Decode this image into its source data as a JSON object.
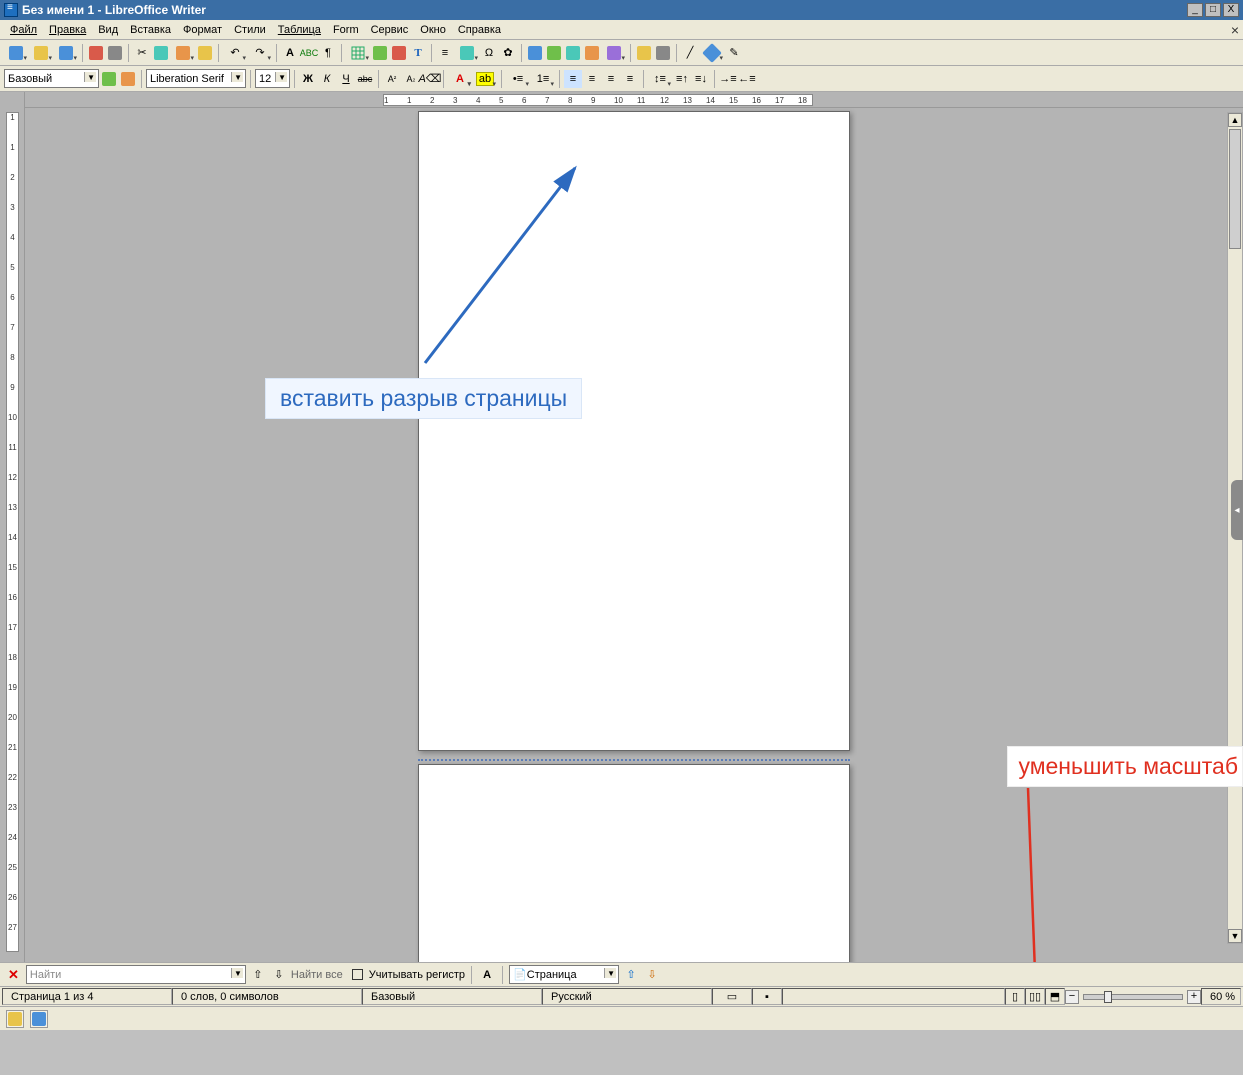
{
  "window": {
    "title": "Без имени 1 - LibreOffice Writer"
  },
  "menus": {
    "file": "Файл",
    "edit": "Правка",
    "view": "Вид",
    "insert": "Вставка",
    "format": "Формат",
    "styles": "Стили",
    "table": "Таблица",
    "form": "Form",
    "tools": "Сервис",
    "window": "Окно",
    "help": "Справка"
  },
  "formatbar": {
    "paragraph_style": "Базовый",
    "font_name": "Liberation Serif",
    "font_size": "12",
    "bold": "Ж",
    "italic": "К",
    "underline": "Ч",
    "strike": "abc"
  },
  "find": {
    "placeholder": "Найти",
    "find_all": "Найти все",
    "case_label": "Учитывать регистр",
    "nav_dropdown": "Страница"
  },
  "status": {
    "page": "Страница 1 из 4",
    "words": "0 слов, 0 символов",
    "style": "Базовый",
    "language": "Русский",
    "zoom": "60 %"
  },
  "hruler_ticks": [
    "1",
    "1",
    "2",
    "3",
    "4",
    "5",
    "6",
    "7",
    "8",
    "9",
    "10",
    "11",
    "12",
    "13",
    "14",
    "15",
    "16",
    "17",
    "18"
  ],
  "vruler_ticks": [
    "1",
    "1",
    "2",
    "3",
    "4",
    "5",
    "6",
    "7",
    "8",
    "9",
    "10",
    "11",
    "12",
    "13",
    "14",
    "15",
    "16",
    "17",
    "18",
    "19",
    "20",
    "21",
    "22",
    "23",
    "24",
    "25",
    "26",
    "27"
  ],
  "annotations": {
    "insert_break": "вставить разрыв страницы",
    "zoom_out": "уменьшить масштаб"
  }
}
